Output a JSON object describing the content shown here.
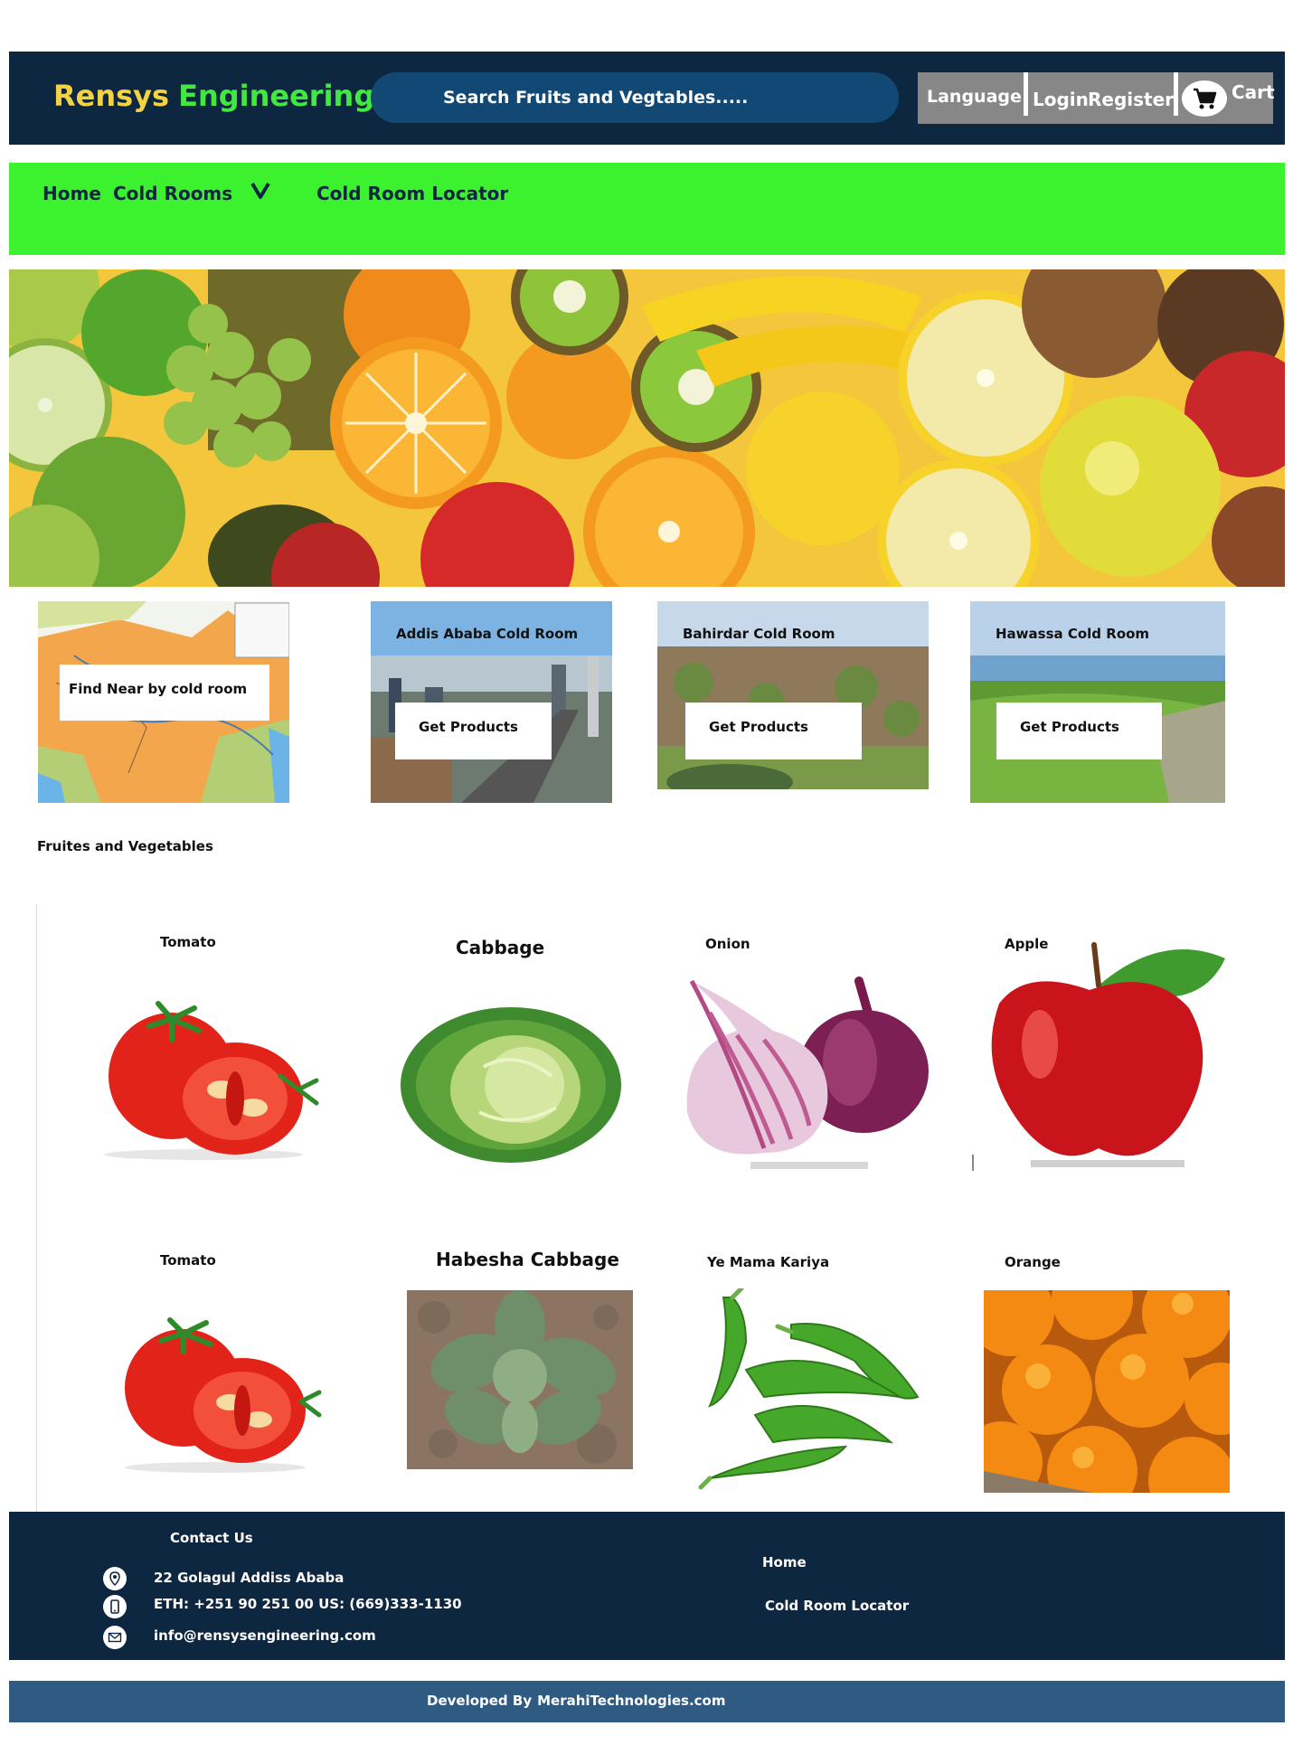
{
  "header": {
    "brand_part1": "Rensys",
    "brand_part2": "Engineering",
    "search_placeholder": "Search Fruits and Vegtables.....",
    "language_label": "Language",
    "login_label": "Login",
    "register_label": "Register",
    "cart_label": "Cart",
    "cart_icon": "cart-icon"
  },
  "nav": {
    "items": [
      {
        "label": "Home"
      },
      {
        "label": "Cold Rooms"
      },
      {
        "label": "Cold Room Locator"
      }
    ],
    "dropdown_icon": "chevron-down-icon"
  },
  "hero": {
    "image": "assorted-fruits-banner"
  },
  "locator_card": {
    "label": "Find Near by cold room",
    "image": "ethiopia-map"
  },
  "cold_rooms": [
    {
      "title": "Addis Ababa Cold Room",
      "button": "Get Products"
    },
    {
      "title": "Bahirdar Cold Room",
      "button": "Get Products"
    },
    {
      "title": "Hawassa Cold Room",
      "button": "Get Products"
    }
  ],
  "products_section": {
    "title": "Fruites and Vegetables",
    "items": [
      {
        "name": "Tomato",
        "image": "tomato"
      },
      {
        "name": "Cabbage",
        "image": "cabbage"
      },
      {
        "name": "Onion",
        "image": "onion"
      },
      {
        "name": "Apple",
        "image": "apple"
      },
      {
        "name": "Tomato",
        "image": "tomato"
      },
      {
        "name": "Habesha Cabbage",
        "image": "kale-plant"
      },
      {
        "name": "Ye  Mama  Kariya",
        "image": "green-chili-peppers"
      },
      {
        "name": "Orange",
        "image": "oranges"
      }
    ]
  },
  "footer": {
    "contact_title": "Contact Us",
    "address": "22 Golagul Addiss Ababa",
    "phone": "ETH: +251 90 251 00 US: (669)333-1130",
    "email": "info@rensysengineering.com",
    "links": [
      "Home",
      "Cold Room  Locator"
    ],
    "icons": [
      "location-pin-icon",
      "phone-icon",
      "mail-icon"
    ]
  },
  "devbar": {
    "prefix": "Developed By",
    "company": "MerahiTechnologies.com"
  },
  "colors": {
    "header_bg": "#0e2740",
    "nav_bg": "#3cf22e",
    "search_bg": "#124874",
    "devbar_bg": "#2f5b82",
    "brand_yellow": "#f3d342",
    "brand_green": "#42e842"
  }
}
